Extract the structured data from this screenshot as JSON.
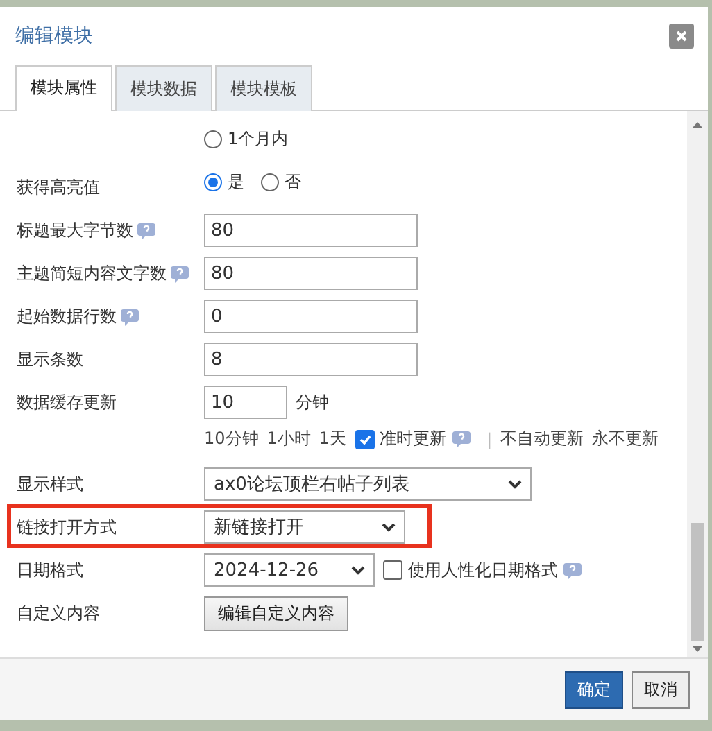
{
  "dialog": {
    "title": "编辑模块"
  },
  "tabs": [
    {
      "label": "模块属性",
      "selected": true
    },
    {
      "label": "模块数据",
      "selected": false
    },
    {
      "label": "模块模板",
      "selected": false
    }
  ],
  "rows": [
    {
      "kind": "radios",
      "options": [
        {
          "label": "1个月内",
          "selected": false
        }
      ]
    },
    {
      "kind": "radios",
      "label": "获得高亮值",
      "options": [
        {
          "label": "是",
          "selected": true
        },
        {
          "label": "否",
          "selected": false
        }
      ]
    },
    {
      "kind": "text",
      "label": "标题最大字节数",
      "help": true,
      "value": "80"
    },
    {
      "kind": "text",
      "label": "主题简短内容文字数",
      "help": true,
      "value": "80"
    },
    {
      "kind": "text",
      "label": "起始数据行数",
      "help": true,
      "value": "0"
    },
    {
      "kind": "text",
      "label": "显示条数",
      "value": "8"
    },
    {
      "kind": "cache",
      "label": "数据缓存更新",
      "value": "10",
      "unit": "分钟",
      "presets": [
        "10分钟",
        "1小时",
        "1天"
      ],
      "checkbox": {
        "label": "准时更新",
        "checked": true,
        "help": true
      },
      "separator": "|",
      "options": [
        "不自动更新",
        "永不更新"
      ]
    },
    {
      "kind": "select",
      "label": "显示样式",
      "value": "ax0论坛顶栏右帖子列表"
    },
    {
      "kind": "select",
      "label": "链接打开方式",
      "value": "新链接打开",
      "highlighted": true
    },
    {
      "kind": "date",
      "label": "日期格式",
      "value": "2024-12-26",
      "checkbox": {
        "label": "使用人性化日期格式",
        "checked": false,
        "help": true
      }
    },
    {
      "kind": "button",
      "label": "自定义内容",
      "button": "编辑自定义内容"
    }
  ],
  "buttons": [
    {
      "label": "确定",
      "kind": "primary"
    },
    {
      "label": "取消",
      "kind": "plain"
    }
  ]
}
